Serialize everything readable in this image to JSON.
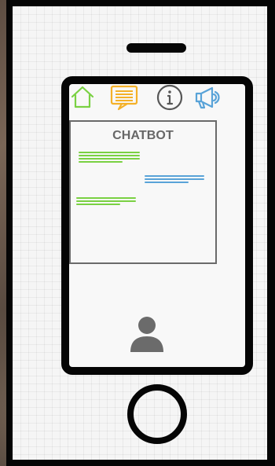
{
  "chat": {
    "title": "CHATBOT",
    "messages": [
      {
        "sender": "user",
        "color": "#7ad143",
        "lines": [
          78,
          78,
          78,
          56
        ]
      },
      {
        "sender": "bot",
        "color": "#59a3d8",
        "lines": [
          76,
          76,
          56
        ]
      },
      {
        "sender": "user",
        "color": "#7ad143",
        "lines": [
          76,
          76,
          56
        ]
      }
    ]
  },
  "icons": {
    "home": "home-icon",
    "chat": "chat-icon",
    "info": "info-icon",
    "megaphone": "megaphone-icon",
    "profile": "profile-icon"
  },
  "colors": {
    "home": "#7ad143",
    "chat": "#f4b128",
    "info": "#575757",
    "megaphone": "#59a3d8",
    "profile": "#6b6b6b"
  }
}
